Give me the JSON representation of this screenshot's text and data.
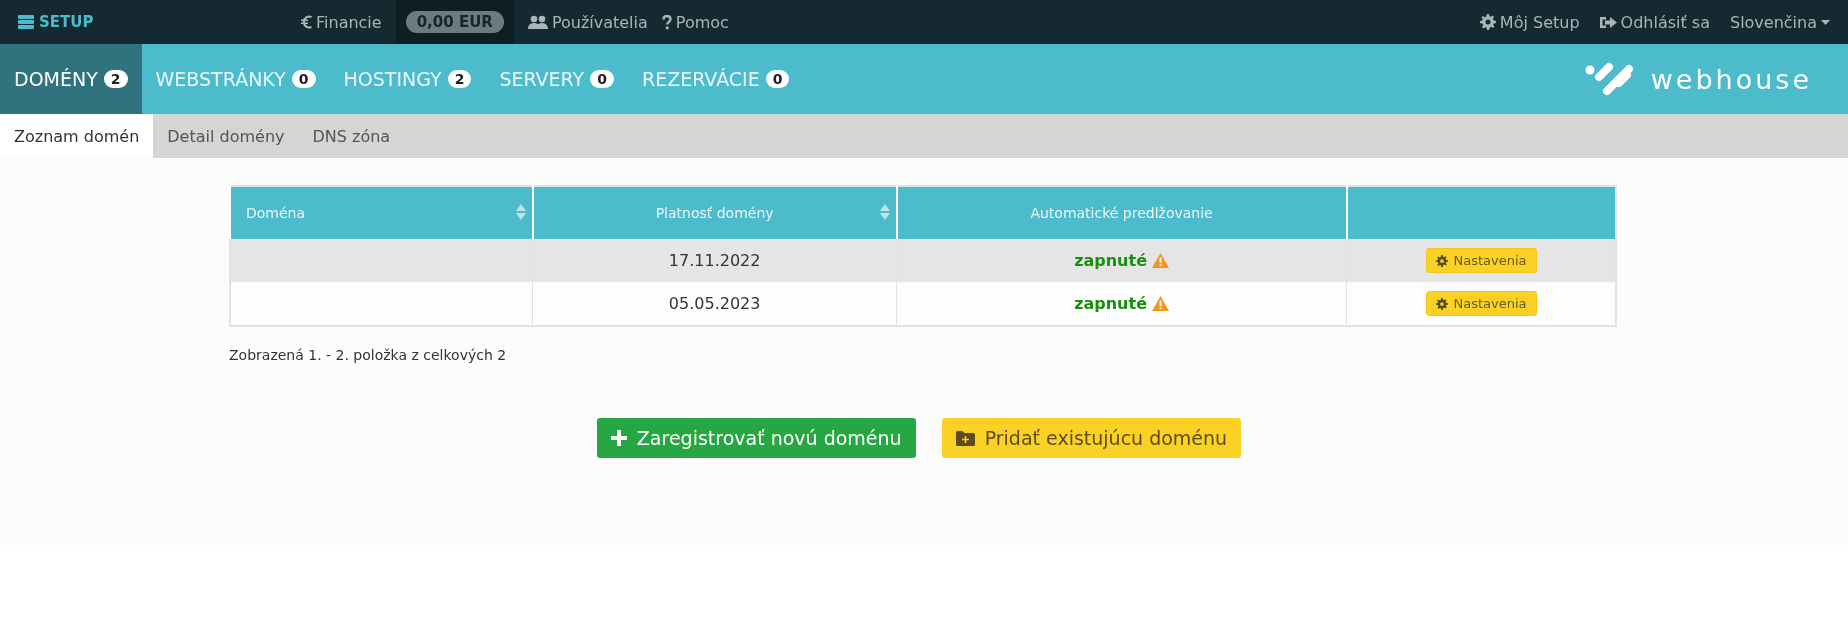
{
  "top_bar": {
    "brand": "SETUP",
    "links": [
      {
        "kind": "financie",
        "label": "Financie"
      },
      {
        "kind": "balance",
        "label": "0,00 EUR"
      },
      {
        "kind": "users",
        "label": "Používatelia"
      },
      {
        "kind": "help",
        "label": "Pomoc"
      }
    ],
    "right_links": [
      {
        "kind": "settings",
        "label": "Môj Setup"
      },
      {
        "kind": "logout",
        "label": "Odhlásiť sa"
      },
      {
        "kind": "language",
        "label": "Slovenčina"
      }
    ]
  },
  "main_tabs": [
    {
      "label": "DOMÉNY",
      "count": "2",
      "selected": true
    },
    {
      "label": "WEBSTRÁNKY",
      "count": "0",
      "selected": false
    },
    {
      "label": "HOSTINGY",
      "count": "2",
      "selected": false
    },
    {
      "label": "SERVERY",
      "count": "0",
      "selected": false
    },
    {
      "label": "REZERVÁCIE",
      "count": "0",
      "selected": false
    }
  ],
  "logo": "webhouse",
  "sub_tabs": [
    {
      "label": "Zoznam domén",
      "selected": true
    },
    {
      "label": "Detail domény",
      "selected": false
    },
    {
      "label": "DNS zóna",
      "selected": false
    }
  ],
  "table": {
    "columns": [
      {
        "label": "Doména",
        "sortable": true
      },
      {
        "label": "Platnosť domény",
        "sortable": true
      },
      {
        "label": "Automatické predlžovanie",
        "sortable": false
      },
      {
        "sortable": false
      }
    ],
    "rows": [
      {
        "validity": "17.11.2022",
        "renewal": "zapnuté",
        "warning": true,
        "action": "Nastavenia"
      },
      {
        "validity": "05.05.2023",
        "renewal": "zapnuté",
        "warning": true,
        "action": "Nastavenia"
      }
    ]
  },
  "summary": "Zobrazená 1. - 2. položka z celkových 2",
  "buttons": [
    {
      "kind": "register",
      "label": "Zaregistrovať novú doménu"
    },
    {
      "kind": "add",
      "label": "Pridať existujúcu doménu"
    }
  ]
}
